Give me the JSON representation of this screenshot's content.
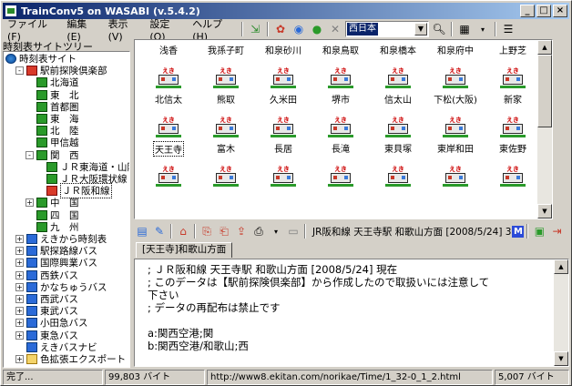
{
  "window": {
    "title": "TrainConv5 on WASABI (v.5.4.2)"
  },
  "menu": [
    "ファイル(F)",
    "編集(E)",
    "表示(V)",
    "設定(O)",
    "ヘルプ(H)"
  ],
  "toolbar": {
    "combo_value": "西日本"
  },
  "tree": {
    "label": "時刻表サイトツリー",
    "items": [
      {
        "label": "時刻表サイト",
        "icon": "globe-icon",
        "level": 0,
        "expander": ""
      },
      {
        "label": "駅前探険倶楽部",
        "icon": "trainr-icon",
        "level": 1,
        "expander": "-"
      },
      {
        "label": "北海道",
        "icon": "train-icon",
        "level": 2,
        "expander": ""
      },
      {
        "label": "東　北",
        "icon": "train-icon",
        "level": 2,
        "expander": ""
      },
      {
        "label": "首都圏",
        "icon": "train-icon",
        "level": 2,
        "expander": ""
      },
      {
        "label": "東　海",
        "icon": "train-icon",
        "level": 2,
        "expander": ""
      },
      {
        "label": "北　陸",
        "icon": "train-icon",
        "level": 2,
        "expander": ""
      },
      {
        "label": "甲信越",
        "icon": "train-icon",
        "level": 2,
        "expander": ""
      },
      {
        "label": "関　西",
        "icon": "train-icon",
        "level": 2,
        "expander": "-"
      },
      {
        "label": "ＪＲ東海道・山陽",
        "icon": "train-icon",
        "level": 3,
        "expander": ""
      },
      {
        "label": "ＪＲ大阪環状線",
        "icon": "train-icon",
        "level": 3,
        "expander": ""
      },
      {
        "label": "ＪＲ阪和線",
        "icon": "trainr-icon",
        "level": 3,
        "expander": "",
        "selected": true
      },
      {
        "label": "中　国",
        "icon": "train-icon",
        "level": 2,
        "expander": "+"
      },
      {
        "label": "四　国",
        "icon": "train-icon",
        "level": 2,
        "expander": ""
      },
      {
        "label": "九　州",
        "icon": "train-icon",
        "level": 2,
        "expander": ""
      },
      {
        "label": "えきから時刻表",
        "icon": "bus-icon",
        "level": 1,
        "expander": "+"
      },
      {
        "label": "駅探路線バス",
        "icon": "bus-icon",
        "level": 1,
        "expander": "+"
      },
      {
        "label": "国際興業バス",
        "icon": "bus-icon",
        "level": 1,
        "expander": "+"
      },
      {
        "label": "西鉄バス",
        "icon": "bus-icon",
        "level": 1,
        "expander": "+"
      },
      {
        "label": "かなちゅうバス",
        "icon": "bus-icon",
        "level": 1,
        "expander": "+"
      },
      {
        "label": "西武バス",
        "icon": "bus-icon",
        "level": 1,
        "expander": "+"
      },
      {
        "label": "東武バス",
        "icon": "bus-icon",
        "level": 1,
        "expander": "+"
      },
      {
        "label": "小田急バス",
        "icon": "bus-icon",
        "level": 1,
        "expander": "+"
      },
      {
        "label": "東急バス",
        "icon": "bus-icon",
        "level": 1,
        "expander": "+"
      },
      {
        "label": "えきバスナビ",
        "icon": "bus-icon",
        "level": 1,
        "expander": ""
      },
      {
        "label": "色拡張エクスポート",
        "icon": "folder-icon",
        "level": 1,
        "expander": "+"
      }
    ]
  },
  "stations": {
    "rows": [
      [
        "浅香",
        "我孫子町",
        "和泉砂川",
        "和泉鳥取",
        "和泉橋本",
        "和泉府中",
        "上野芝"
      ],
      [
        "北信太",
        "熊取",
        "久米田",
        "堺市",
        "信太山",
        "下松(大阪)",
        "新家"
      ],
      [
        "天王寺",
        "富木",
        "長居",
        "長滝",
        "東貝塚",
        "東岸和田",
        "東佐野"
      ],
      [
        "",
        "",
        "",
        "",
        "",
        "",
        ""
      ]
    ],
    "selected": "天王寺"
  },
  "lower_toolbar": {
    "path": "JR阪和線 天王寺駅 和歌山方面 [2008/5/24] 3"
  },
  "tab": {
    "label": "[天王寺]和歌山方面"
  },
  "content_lines": [
    "; ＪＲ阪和線 天王寺駅 和歌山方面 [2008/5/24] 現在",
    "; このデータは【駅前探険倶楽部】から作成したので取扱いには注意して",
    "下さい",
    "; データの再配布は禁止です",
    "",
    "a:関西空港;関",
    "b:関西空港/和歌山;西"
  ],
  "status": {
    "state": "完了...",
    "size1": "99,803 バイト",
    "url": "http://www8.ekitan.com/norikae/Time/1_32-0_1_2.html",
    "size2": "5,007 バイト"
  }
}
